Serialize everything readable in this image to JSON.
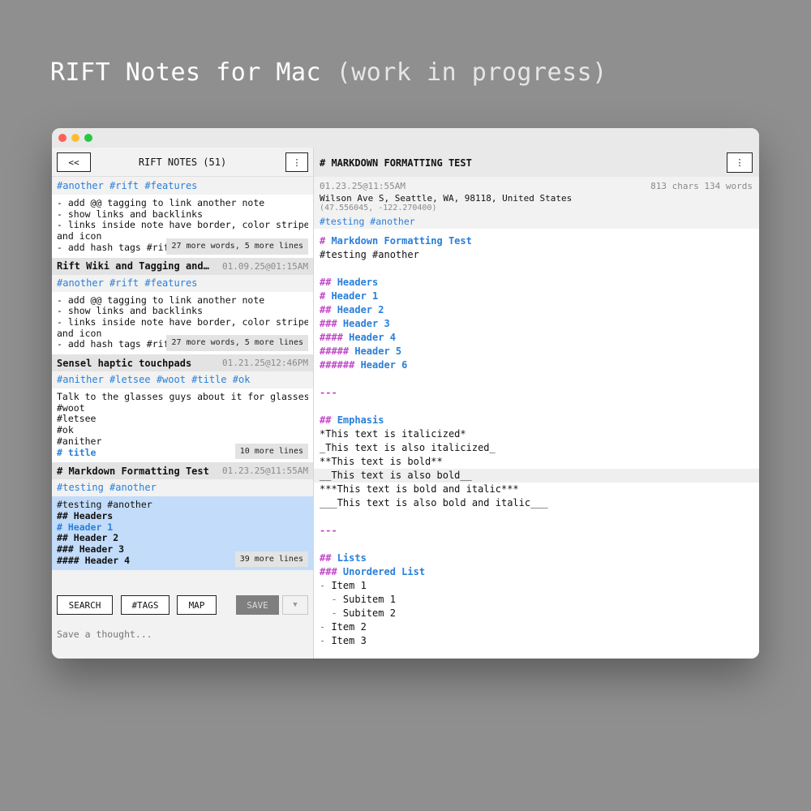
{
  "page": {
    "title_main": "RIFT Notes for Mac",
    "title_sub": "(work in progress)"
  },
  "sidebar": {
    "back_label": "<<",
    "title": "RIFT NOTES (51)",
    "menu_label": "⋮",
    "notes": [
      {
        "title": "",
        "date": "",
        "tags": "#another #rift #features",
        "lines": [
          "- add @@ tagging to link another note",
          "- show links and backlinks",
          "- links inside note have border, color stripe",
          "and icon",
          "- add hash tags #rif"
        ],
        "more": "27 more words, 5 more lines"
      },
      {
        "title": "Rift Wiki and Tagging and…",
        "date": "01.09.25@01:15AM",
        "tags": "#another #rift #features",
        "lines": [
          "- add @@ tagging to link another note",
          "- show links and backlinks",
          "- links inside note have border, color stripe",
          "and icon",
          "- add hash tags #rif"
        ],
        "more": "27 more words, 5 more lines"
      },
      {
        "title": "Sensel haptic touchpads",
        "date": "01.21.25@12:46PM",
        "tags": "#anither #letsee #woot #title #ok",
        "lines": [
          "Talk to the glasses guys about it for glasses",
          "#woot",
          "#letsee",
          "#ok",
          "#anither",
          "# title"
        ],
        "more": "10 more lines"
      },
      {
        "title": "# Markdown Formatting Test",
        "date": "01.23.25@11:55AM",
        "tags": "#testing #another",
        "lines": [
          "#testing #another",
          "## Headers",
          "# Header 1",
          "## Header 2",
          "### Header 3",
          "#### Header 4"
        ],
        "more": "39 more lines"
      }
    ],
    "toolbar": {
      "search": "SEARCH",
      "tags": "#TAGS",
      "map": "MAP",
      "save": "SAVE",
      "dropdown": "▼"
    },
    "thought_placeholder": "Save a thought..."
  },
  "detail": {
    "title": "# MARKDOWN FORMATTING TEST",
    "menu_label": "⋮",
    "date": "01.23.25@11:55AM",
    "counts": "813 chars  134 words",
    "address": "Wilson Ave S, Seattle, WA, 98118, United States",
    "coords": "(47.556045, -122.270400)",
    "tags": "#testing #another",
    "lines": [
      {
        "marker": "# ",
        "text": "Markdown Formatting Test",
        "style": "header"
      },
      {
        "marker": "",
        "text": "#testing #another",
        "style": "plain"
      },
      {
        "marker": "",
        "text": "",
        "style": "plain"
      },
      {
        "marker": "## ",
        "text": "Headers",
        "style": "header"
      },
      {
        "marker": "# ",
        "text": "Header 1",
        "style": "header"
      },
      {
        "marker": "## ",
        "text": "Header 2",
        "style": "header"
      },
      {
        "marker": "### ",
        "text": "Header 3",
        "style": "header"
      },
      {
        "marker": "#### ",
        "text": "Header 4",
        "style": "header"
      },
      {
        "marker": "##### ",
        "text": "Header 5",
        "style": "header"
      },
      {
        "marker": "###### ",
        "text": "Header 6",
        "style": "header"
      },
      {
        "marker": "",
        "text": "",
        "style": "plain"
      },
      {
        "marker": "---",
        "text": "",
        "style": "rule"
      },
      {
        "marker": "",
        "text": "",
        "style": "plain"
      },
      {
        "marker": "## ",
        "text": "Emphasis",
        "style": "header"
      },
      {
        "marker": "",
        "text": "*This text is italicized*",
        "style": "plain"
      },
      {
        "marker": "",
        "text": "_This text is also italicized_",
        "style": "plain"
      },
      {
        "marker": "",
        "text": "**This text is bold**",
        "style": "plain"
      },
      {
        "marker": "",
        "text": "__This text is also bold__",
        "style": "plain",
        "highlight": true
      },
      {
        "marker": "",
        "text": "***This text is bold and italic***",
        "style": "plain"
      },
      {
        "marker": "",
        "text": "___This text is also bold and italic___",
        "style": "plain"
      },
      {
        "marker": "",
        "text": "",
        "style": "plain"
      },
      {
        "marker": "---",
        "text": "",
        "style": "rule"
      },
      {
        "marker": "",
        "text": "",
        "style": "plain"
      },
      {
        "marker": "## ",
        "text": "Lists",
        "style": "header"
      },
      {
        "marker": "### ",
        "text": "Unordered List",
        "style": "header"
      },
      {
        "marker": "- ",
        "text": "Item 1",
        "style": "list"
      },
      {
        "marker": "  - ",
        "text": "Subitem 1",
        "style": "list"
      },
      {
        "marker": "  - ",
        "text": "Subitem 2",
        "style": "list"
      },
      {
        "marker": "- ",
        "text": "Item 2",
        "style": "list"
      },
      {
        "marker": "- ",
        "text": "Item 3",
        "style": "list"
      }
    ]
  },
  "colors": {
    "accent_blue": "#2a7fd8",
    "markdown_marker": "#c24ac9",
    "selection": "#c3dcf9"
  }
}
